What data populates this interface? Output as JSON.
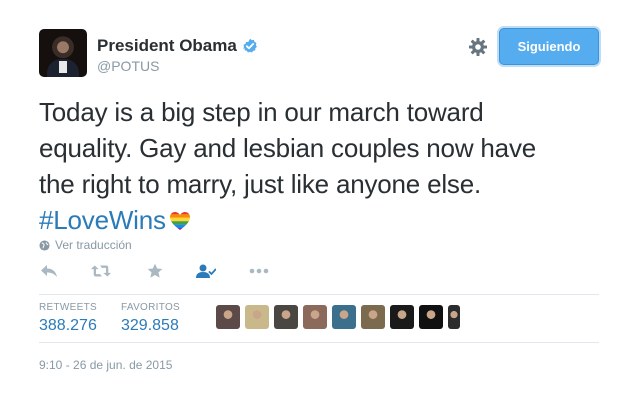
{
  "user": {
    "name": "President Obama",
    "handle": "@POTUS"
  },
  "follow_button": {
    "label": "Siguiendo"
  },
  "tweet": {
    "text_line1": "Today is a big step in our march toward",
    "text_line2": "equality. Gay and lesbian couples now have",
    "text_line3": "the right to marry, just like anyone else.",
    "hashtag": "#LoveWins"
  },
  "translate_link": "Ver traducción",
  "actions": [
    "reply-icon",
    "retweet-icon",
    "favorite-icon",
    "follow-icon",
    "more-icon"
  ],
  "stats": {
    "retweets_label": "RETWEETS",
    "retweets_value": "388.276",
    "favorites_label": "FAVORITOS",
    "favorites_value": "329.858"
  },
  "timestamp": "9:10 - 26 de jun. de 2015",
  "colors": {
    "accent": "#55acee",
    "link": "#2b7bb9",
    "muted": "#8899a6",
    "text": "#292f33"
  },
  "favoriter_avatars": [
    {
      "label": "favoriter-1",
      "color": "#5b4a48"
    },
    {
      "label": "favoriter-2",
      "color": "#c9b98a"
    },
    {
      "label": "favoriter-3",
      "color": "#4a4642"
    },
    {
      "label": "favoriter-4",
      "color": "#8b6a5c"
    },
    {
      "label": "favoriter-5",
      "color": "#3c6f8c"
    },
    {
      "label": "favoriter-6",
      "color": "#7c6a4e"
    },
    {
      "label": "favoriter-7",
      "color": "#1a1a1a"
    },
    {
      "label": "favoriter-8",
      "color": "#101010"
    },
    {
      "label": "favoriter-9",
      "color": "#2c2c2c"
    }
  ]
}
